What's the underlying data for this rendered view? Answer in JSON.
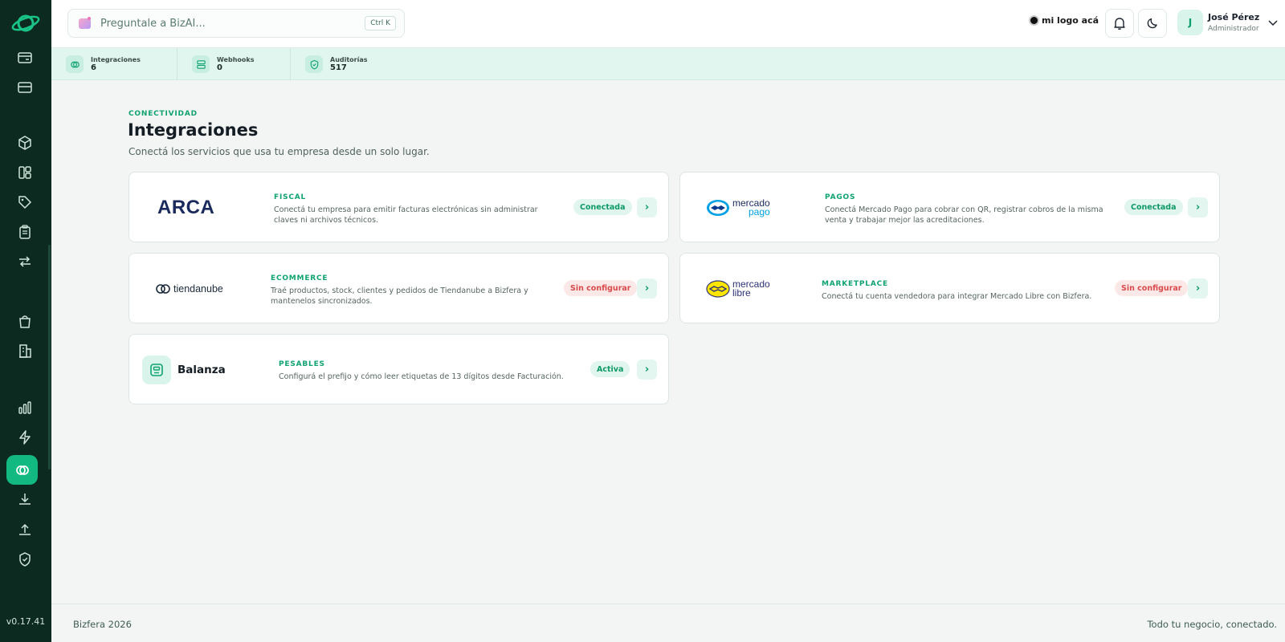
{
  "app": {
    "version": "v0.17.41"
  },
  "search": {
    "placeholder": "Preguntale a BizAI...",
    "shortcut": "Ctrl K"
  },
  "header": {
    "brand_label": "mi logo acá",
    "user": {
      "initial": "J",
      "name": "José Pérez",
      "role": "Administrador"
    }
  },
  "sidebar": {
    "items": [
      {
        "icon": "register-icon"
      },
      {
        "icon": "card-icon"
      },
      {
        "icon": "box-icon"
      },
      {
        "icon": "layout-icon"
      },
      {
        "icon": "tag-icon"
      },
      {
        "icon": "clipboard-icon"
      },
      {
        "icon": "transfer-icon"
      },
      {
        "icon": "bag-icon"
      },
      {
        "icon": "building-icon"
      },
      {
        "icon": "chart-icon"
      },
      {
        "icon": "bolt-icon"
      },
      {
        "icon": "integrations-icon",
        "active": true
      },
      {
        "icon": "download-icon"
      },
      {
        "icon": "upload-icon"
      },
      {
        "icon": "shield-icon"
      }
    ]
  },
  "stats": [
    {
      "label": "Integraciones",
      "value": "6",
      "icon": "integrations-icon"
    },
    {
      "label": "Webhooks",
      "value": "0",
      "icon": "server-icon"
    },
    {
      "label": "Auditorías",
      "value": "517",
      "icon": "shield-check-icon"
    }
  ],
  "page": {
    "eyebrow": "CONECTIVIDAD",
    "title": "Integraciones",
    "subtitle": "Conectá los servicios que usa tu empresa desde un solo lugar."
  },
  "integrations": [
    {
      "logo_text": "ARCA",
      "category": "FISCAL",
      "description": "Conectá tu empresa para emitir facturas electrónicas sin administrar claves ni archivos técnicos.",
      "status": "Conectada",
      "status_color": "#0d9a68"
    },
    {
      "logo_text_1": "mercado",
      "logo_text_2": "pago",
      "category": "PAGOS",
      "description": "Conectá Mercado Pago para cobrar con QR, registrar cobros de la misma venta y trabajar mejor las acreditaciones.",
      "status": "Conectada",
      "status_color": "#0d9a68"
    },
    {
      "logo_text": "tiendanube",
      "category": "ECOMMERCE",
      "description": "Traé productos, stock, clientes y pedidos de Tiendanube a Bizfera y mantenelos sincronizados.",
      "status": "Sin configurar",
      "status_color": "#d94b4b"
    },
    {
      "logo_text_1": "mercado",
      "logo_text_2": "libre",
      "category": "MARKETPLACE",
      "description": "Conectá tu cuenta vendedora para integrar Mercado Libre con Bizfera.",
      "status": "Sin configurar",
      "status_color": "#d94b4b"
    },
    {
      "logo_text": "Balanza",
      "category": "PESABLES",
      "description": "Configurá el prefijo y cómo leer etiquetas de 13 dígitos desde Facturación.",
      "status": "Activa",
      "status_color": "#0d9a68"
    }
  ],
  "footer": {
    "left": "Bizfera 2026",
    "right": "Todo tu negocio, conectado."
  },
  "colors": {
    "sidebar": "#0d2a20",
    "accent": "#12b981",
    "accent_text": "#10a36f"
  }
}
